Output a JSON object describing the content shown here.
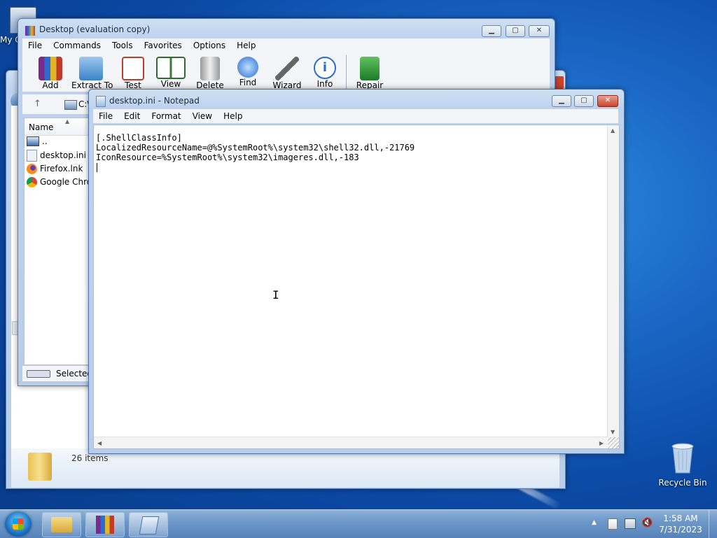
{
  "desktop": {
    "my_computer_label": "My C",
    "recycle_bin_label": "Recycle Bin"
  },
  "explorer_window": {
    "status_items": "26 items"
  },
  "winrar": {
    "title": "Desktop (evaluation copy)",
    "menu": [
      "File",
      "Commands",
      "Tools",
      "Favorites",
      "Options",
      "Help"
    ],
    "toolbar": [
      {
        "label": "Add",
        "icon": "add-archive-icon"
      },
      {
        "label": "Extract To",
        "icon": "extract-folder-icon"
      },
      {
        "label": "Test",
        "icon": "test-icon"
      },
      {
        "label": "View",
        "icon": "view-book-icon"
      },
      {
        "label": "Delete",
        "icon": "trash-icon"
      },
      {
        "label": "Find",
        "icon": "magnifier-icon"
      },
      {
        "label": "Wizard",
        "icon": "wand-icon"
      },
      {
        "label": "Info",
        "icon": "info-icon"
      },
      {
        "label": "Repair",
        "icon": "repair-icon"
      }
    ],
    "path_text": "C:\\",
    "column_name": "Name",
    "files": [
      {
        "name": "..",
        "icon": "drive-up-icon"
      },
      {
        "name": "desktop.ini",
        "icon": "ini-file-icon"
      },
      {
        "name": "Firefox.lnk",
        "icon": "firefox-icon"
      },
      {
        "name": "Google Chro",
        "icon": "chrome-icon"
      }
    ],
    "status_text": "Selected"
  },
  "notepad": {
    "title": "desktop.ini - Notepad",
    "menu": [
      "File",
      "Edit",
      "Format",
      "View",
      "Help"
    ],
    "content": "[.ShellClassInfo]\nLocalizedResourceName=@%SystemRoot%\\system32\\shell32.dll,-21769\nIconResource=%SystemRoot%\\system32\\imageres.dll,-183\n"
  },
  "taskbar": {
    "time": "1:58 AM",
    "date": "7/31/2023"
  },
  "colors": {
    "accent": "#1b68c6",
    "title_bar": "#bcd2ee",
    "close_button": "#c9442b"
  }
}
